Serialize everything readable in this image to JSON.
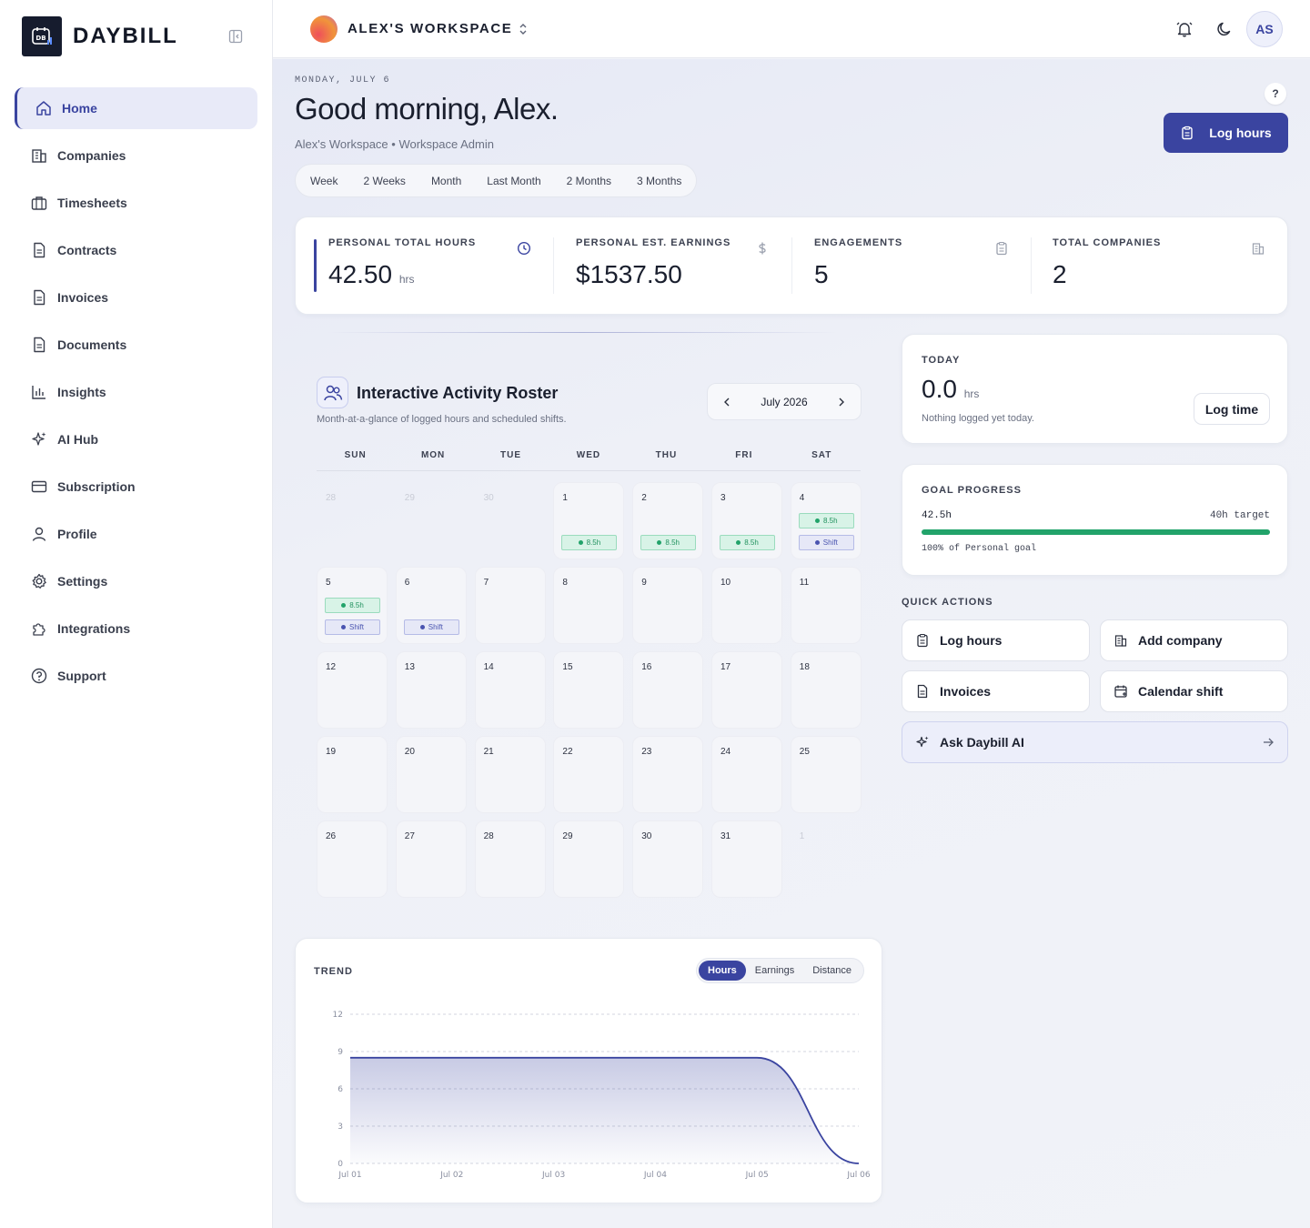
{
  "brand": {
    "name": "DAYBILL",
    "logo_text": "DB"
  },
  "sidebar": {
    "items": [
      {
        "label": "Home",
        "icon": "home-icon",
        "active": true
      },
      {
        "label": "Companies",
        "icon": "building-icon"
      },
      {
        "label": "Timesheets",
        "icon": "briefcase-icon"
      },
      {
        "label": "Contracts",
        "icon": "file-icon"
      },
      {
        "label": "Invoices",
        "icon": "file-icon"
      },
      {
        "label": "Documents",
        "icon": "file-icon"
      },
      {
        "label": "Insights",
        "icon": "bar-chart-icon"
      },
      {
        "label": "AI Hub",
        "icon": "sparkles-icon"
      },
      {
        "label": "Subscription",
        "icon": "credit-card-icon"
      },
      {
        "label": "Profile",
        "icon": "user-icon"
      },
      {
        "label": "Settings",
        "icon": "gear-icon"
      },
      {
        "label": "Integrations",
        "icon": "puzzle-icon"
      },
      {
        "label": "Support",
        "icon": "help-circle-icon"
      }
    ]
  },
  "topbar": {
    "workspace_name": "ALEX'S WORKSPACE",
    "user_initials": "AS"
  },
  "header": {
    "date": "MONDAY, JULY 6",
    "greeting": "Good morning, Alex.",
    "subtitle": "Alex's Workspace • Workspace Admin",
    "help": "?",
    "log_hours_label": "Log hours"
  },
  "ranges": [
    "Week",
    "2 Weeks",
    "Month",
    "Last Month",
    "2 Months",
    "3 Months"
  ],
  "stats": [
    {
      "label": "PERSONAL TOTAL HOURS",
      "value": "42.50",
      "unit": "hrs",
      "icon": "clock-icon"
    },
    {
      "label": "PERSONAL EST. EARNINGS",
      "value": "$1537.50",
      "unit": "",
      "icon": "dollar-icon"
    },
    {
      "label": "ENGAGEMENTS",
      "value": "5",
      "unit": "",
      "icon": "clipboard-icon"
    },
    {
      "label": "TOTAL COMPANIES",
      "value": "2",
      "unit": "",
      "icon": "building-icon"
    }
  ],
  "roster": {
    "title": "Interactive Activity Roster",
    "subtitle": "Month-at-a-glance of logged hours and scheduled shifts.",
    "month": "July 2026",
    "weekdays": [
      "SUN",
      "MON",
      "TUE",
      "WED",
      "THU",
      "FRI",
      "SAT"
    ],
    "cells": [
      {
        "day": "28",
        "muted": true
      },
      {
        "day": "29",
        "muted": true
      },
      {
        "day": "30",
        "muted": true
      },
      {
        "day": "1",
        "hours": "8.5h"
      },
      {
        "day": "2",
        "hours": "8.5h"
      },
      {
        "day": "3",
        "hours": "8.5h"
      },
      {
        "day": "4",
        "hours": "8.5h",
        "shift": "Shift"
      },
      {
        "day": "5",
        "hours": "8.5h",
        "shift": "Shift"
      },
      {
        "day": "6",
        "shift": "Shift"
      },
      {
        "day": "7"
      },
      {
        "day": "8"
      },
      {
        "day": "9"
      },
      {
        "day": "10"
      },
      {
        "day": "11"
      },
      {
        "day": "12"
      },
      {
        "day": "13"
      },
      {
        "day": "14"
      },
      {
        "day": "15"
      },
      {
        "day": "16"
      },
      {
        "day": "17"
      },
      {
        "day": "18"
      },
      {
        "day": "19"
      },
      {
        "day": "20"
      },
      {
        "day": "21"
      },
      {
        "day": "22"
      },
      {
        "day": "23"
      },
      {
        "day": "24"
      },
      {
        "day": "25"
      },
      {
        "day": "26"
      },
      {
        "day": "27"
      },
      {
        "day": "28"
      },
      {
        "day": "29"
      },
      {
        "day": "30"
      },
      {
        "day": "31"
      },
      {
        "day": "1",
        "muted": true
      }
    ]
  },
  "today": {
    "label": "TODAY",
    "value": "0.0",
    "unit": "hrs",
    "note": "Nothing logged yet today.",
    "button": "Log time"
  },
  "goal": {
    "label": "GOAL PROGRESS",
    "current": "42.5h",
    "target": "40h target",
    "note": "100% of Personal goal",
    "fraction": 1.0
  },
  "quick_actions": {
    "label": "QUICK ACTIONS",
    "items": [
      {
        "label": "Log hours",
        "icon": "clipboard-icon"
      },
      {
        "label": "Add company",
        "icon": "building-icon"
      },
      {
        "label": "Invoices",
        "icon": "file-icon"
      },
      {
        "label": "Calendar shift",
        "icon": "calendar-icon"
      }
    ],
    "ai_label": "Ask Daybill AI"
  },
  "trend": {
    "label": "TREND",
    "metrics": [
      "Hours",
      "Earnings",
      "Distance"
    ],
    "active_metric": "Hours"
  },
  "chart_data": {
    "type": "area",
    "x": [
      "Jul 01",
      "Jul 02",
      "Jul 03",
      "Jul 04",
      "Jul 05",
      "Jul 06"
    ],
    "values": [
      8.5,
      8.5,
      8.5,
      8.5,
      8.5,
      0
    ],
    "yticks": [
      0,
      3,
      6,
      9,
      12
    ],
    "ylim": [
      0,
      12
    ],
    "grid": true,
    "color": "#3a44a0"
  }
}
